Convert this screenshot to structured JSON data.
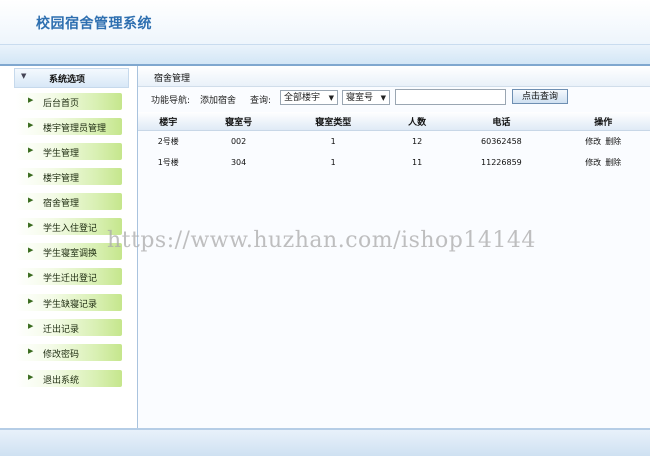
{
  "app": {
    "title": "校园宿舍管理系统"
  },
  "sidebar": {
    "header": "系统选项",
    "items": [
      {
        "label": "后台首页"
      },
      {
        "label": "楼宇管理员管理"
      },
      {
        "label": "学生管理"
      },
      {
        "label": "楼宇管理"
      },
      {
        "label": "宿舍管理"
      },
      {
        "label": "学生入住登记"
      },
      {
        "label": "学生寝室调换"
      },
      {
        "label": "学生迁出登记"
      },
      {
        "label": "学生缺寝记录"
      },
      {
        "label": "迁出记录"
      },
      {
        "label": "修改密码"
      },
      {
        "label": "退出系统"
      }
    ]
  },
  "main": {
    "title": "宿舍管理",
    "toolbar": {
      "nav_label": "功能导航:",
      "add_link": "添加宿舍",
      "query_label": "查询:",
      "building_select": "全部楼宇",
      "field_select": "寝室号",
      "search_value": "",
      "query_button": "点击查询"
    },
    "table": {
      "columns": [
        "楼宇",
        "寝室号",
        "寝室类型",
        "人数",
        "电话",
        "操作"
      ],
      "rows": [
        {
          "building": "2号楼",
          "room": "002",
          "type": "1",
          "count": "12",
          "phone": "60362458",
          "edit": "修改",
          "delete": "删除"
        },
        {
          "building": "1号楼",
          "room": "304",
          "type": "1",
          "count": "11",
          "phone": "11226859",
          "edit": "修改",
          "delete": "删除"
        }
      ]
    }
  },
  "watermark": "https://www.huzhan.com/ishop14144"
}
